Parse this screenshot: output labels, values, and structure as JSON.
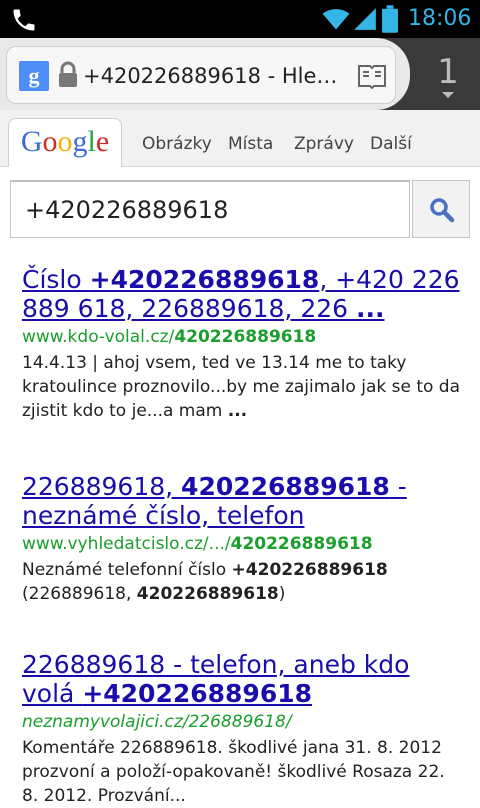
{
  "status_bar": {
    "time": "18:06",
    "icons": [
      "phone-icon",
      "wifi-icon",
      "signal-icon",
      "battery-icon"
    ],
    "accent": "#33b5e5"
  },
  "browser": {
    "favicon_letter": "g",
    "url_text": "+420226889618 - Hle…",
    "tab_count": "1"
  },
  "google_nav": {
    "logo_letters": [
      "G",
      "o",
      "o",
      "g",
      "l",
      "e"
    ],
    "logo_colors": [
      "#3c6bd4",
      "#d6281f",
      "#f1b20b",
      "#3c6bd4",
      "#2ba24c",
      "#d6281f"
    ],
    "items": [
      "Obrázky",
      "Místa",
      "Zprávy",
      "Další"
    ]
  },
  "search": {
    "query": "+420226889618"
  },
  "results": [
    {
      "title_parts": [
        "Číslo ",
        "+420226889618",
        ", +420 226 889 618, 226889618, 226 ",
        "..."
      ],
      "url_parts": [
        "www.kdo-volal.cz/",
        "420226889618"
      ],
      "snippet_parts": [
        "14.4.13 | ahoj vsem, ted ve 13.14 me to taky kratoulince proznovilo...by me zajimalo jak se to da zjistit kdo to je...a mam ",
        "..."
      ]
    },
    {
      "title_parts": [
        "226889618, ",
        "420226889618",
        " - neznámé číslo, telefon"
      ],
      "url_parts": [
        "www.vyhledatcislo.cz/.../",
        "420226889618"
      ],
      "snippet_parts": [
        "Neznámé telefonní číslo ",
        "+420226889618",
        " (226889618, ",
        "420226889618",
        ")"
      ]
    },
    {
      "title_parts": [
        "226889618 - telefon, aneb kdo volá ",
        "+420226889618"
      ],
      "url_parts": [
        "neznamyvolajici.cz/226889618/"
      ],
      "snippet_parts": [
        "Komentáře 226889618. škodlivé jana 31. 8. 2012 prozvoní a položí-opakovaně! škodlivé Rosaza 22. 8. 2012. Prozvání..."
      ]
    }
  ]
}
